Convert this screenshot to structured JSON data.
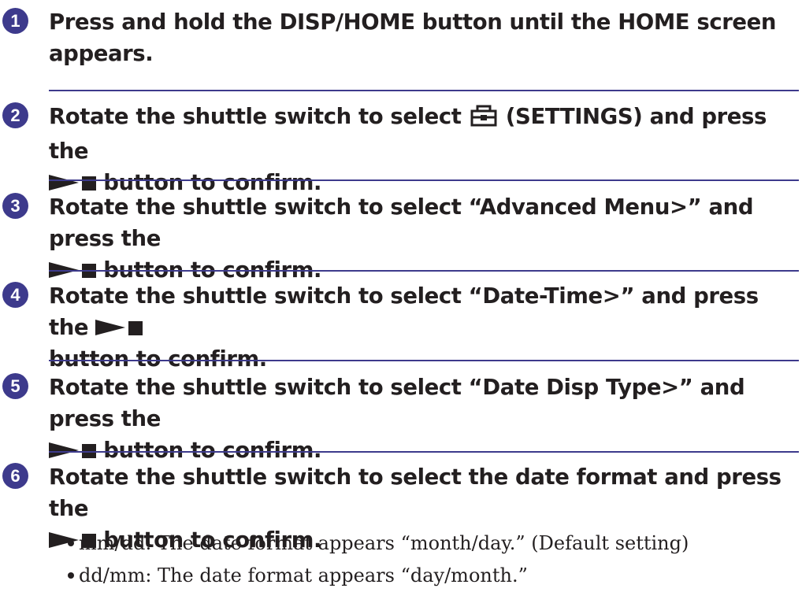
{
  "accent_color": "#3d3a8c",
  "steps": [
    {
      "number": "1",
      "lines": [
        "Press and hold the DISP/HOME button until the HOME screen",
        "appears."
      ]
    },
    {
      "number": "2",
      "line1_pre": "Rotate the shuttle switch to select",
      "line1_post": "(SETTINGS) and press the",
      "line2": "button to confirm.",
      "icon": "settings-icon"
    },
    {
      "number": "3",
      "line1": "Rotate the shuttle switch to select “Advanced Menu>” and press the",
      "line2": "button to confirm.",
      "icon": "play-stop-icon"
    },
    {
      "number": "4",
      "line1": "Rotate the shuttle switch to select “Date-Time>” and press the",
      "line2": "button to confirm.",
      "icon": "play-stop-icon"
    },
    {
      "number": "5",
      "line1": "Rotate the shuttle switch to select “Date Disp Type>” and press the",
      "line2": "button to confirm.",
      "icon": "play-stop-icon"
    },
    {
      "number": "6",
      "line1": "Rotate the shuttle switch to select the date format and press the",
      "line2": "button to confirm.",
      "icon": "play-stop-icon"
    }
  ],
  "options": [
    "mm/dd: The date format appears “month/day.” (Default setting)",
    "dd/mm: The date format appears “day/month.”"
  ]
}
